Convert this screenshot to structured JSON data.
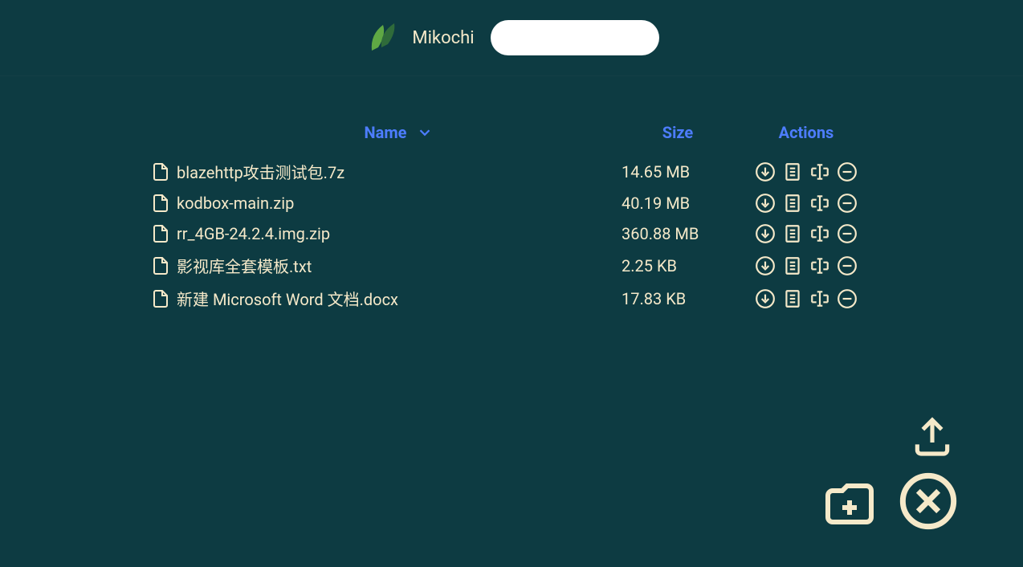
{
  "header": {
    "title": "Mikochi",
    "search_placeholder": ""
  },
  "columns": {
    "name": "Name",
    "size": "Size",
    "actions": "Actions"
  },
  "files": [
    {
      "name": "blazehttp攻击测试包.7z",
      "size": "14.65 MB"
    },
    {
      "name": "kodbox-main.zip",
      "size": "40.19 MB"
    },
    {
      "name": "rr_4GB-24.2.4.img.zip",
      "size": "360.88 MB"
    },
    {
      "name": "影视库全套模板.txt",
      "size": "2.25 KB"
    },
    {
      "name": "新建 Microsoft Word 文档.docx",
      "size": "17.83 KB"
    }
  ]
}
